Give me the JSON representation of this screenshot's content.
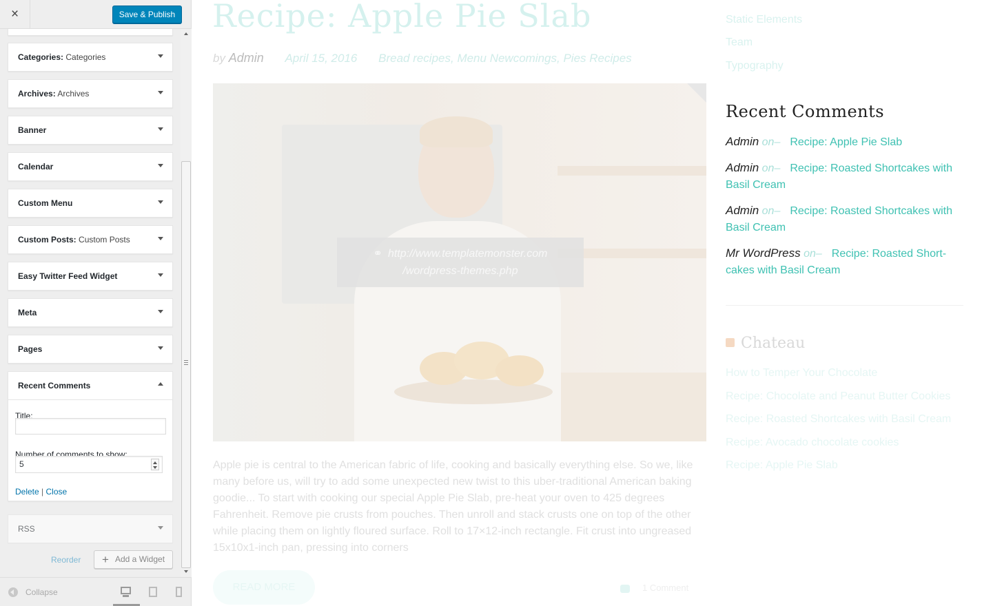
{
  "sidebar": {
    "close_icon": "×",
    "save_label": "Save & Publish",
    "widgets": [
      {
        "title": "Categories:",
        "subtitle": "Categories"
      },
      {
        "title": "Archives:",
        "subtitle": "Archives"
      },
      {
        "title": "Banner",
        "subtitle": ""
      },
      {
        "title": "Calendar",
        "subtitle": ""
      },
      {
        "title": "Custom Menu",
        "subtitle": ""
      },
      {
        "title": "Custom Posts:",
        "subtitle": "Custom Posts"
      },
      {
        "title": "Easy Twitter Feed Widget",
        "subtitle": ""
      },
      {
        "title": "Meta",
        "subtitle": ""
      },
      {
        "title": "Pages",
        "subtitle": ""
      }
    ],
    "recent_comments_widget": {
      "title": "Recent Comments",
      "title_label": "Title:",
      "title_value": "",
      "number_label": "Number of comments to show:",
      "number_value": "5",
      "delete_label": "Delete",
      "separator": "|",
      "close_label": "Close"
    },
    "rss_widget": {
      "title": "RSS"
    },
    "reorder_label": "Reorder",
    "add_widget_label": "Add a Widget",
    "collapse_label": "Collapse"
  },
  "preview": {
    "post": {
      "title": "Recipe: Apple Pie Slab",
      "by": "by",
      "author": "Admin",
      "date": "April 15, 2016",
      "categories": "Bread recipes, Menu Newcomings, Pies Recipes",
      "link_url_line1": "http://www.templatemonster.com",
      "link_url_line2": "/wordpress-themes.php",
      "excerpt": "Apple pie is central to the American fabric of life, cooking and basically everything else. So we, like many before us, will try to add some unexpected new twist to this uber-traditional American baking goodie... To start with cooking our special Apple Pie Slab, pre-heat your oven to 425 degrees Fahrenheit. Remove pie crusts from pouches. Then unroll and stack crusts one on top of the other while placing them on lightly floured surface. Roll to 17×12-inch rectangle. Fit crust into ungreased 15x10x1-inch pan, pressing into corners",
      "read_more": "READ MORE",
      "comments": "1 Comment"
    },
    "right_column": {
      "top_links": [
        "Static Elements",
        "Team",
        "Typography"
      ],
      "recent_comments_heading": "Recent Comments",
      "recent_comments": [
        {
          "author": "Admin",
          "on": "on–",
          "post": "Recipe: Apple Pie Slab"
        },
        {
          "author": "Admin",
          "on": "on–",
          "post": "Recipe: Roasted Shortcakes with Basil Cream"
        },
        {
          "author": "Admin",
          "on": "on–",
          "post": "Recipe: Roasted Shortcakes with Basil Cream"
        },
        {
          "author": "Mr WordPress",
          "on": "on–",
          "post": "Recipe: Roasted Short-cakes with Basil Cream"
        }
      ],
      "feed_heading": "Chateau",
      "feed_links": [
        "How to Temper Your Chocolate",
        "Recipe: Chocolate and Peanut Butter Cookies",
        "Recipe: Roasted Shortcakes with Basil Cream",
        "Recipe: Avocado chocolate cookies",
        "Recipe: Apple Pie Slab"
      ]
    }
  },
  "colors": {
    "primary_button": "#0085ba",
    "accent_teal": "#3fc1b2",
    "sidebar_bg": "#eeeeee"
  }
}
